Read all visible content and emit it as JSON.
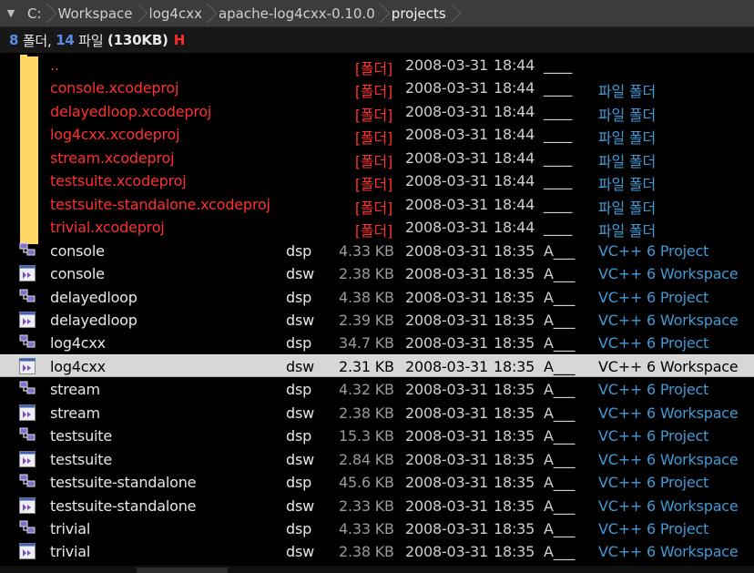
{
  "breadcrumb": [
    "C:",
    "Workspace",
    "log4cxx",
    "apache-log4cxx-0.10.0",
    "projects"
  ],
  "summary": {
    "folders": "8",
    "folder_label": "폴더,",
    "files": "14",
    "file_label": "파일",
    "size": "(130KB)",
    "flag": "H"
  },
  "colors": {
    "folder": "#ff3030",
    "type": "#3f9ad6",
    "count": "#5b8ee8",
    "selected_bg": "#d7d7d7"
  },
  "rows": [
    {
      "kind": "folder",
      "icon": "folder-icon",
      "name": "..",
      "ext": "",
      "size": "[폴더]",
      "date": "2008-03-31",
      "time": "18:44",
      "attr": "____",
      "type": ""
    },
    {
      "kind": "folder",
      "icon": "folder-icon",
      "name": "console.xcodeproj",
      "ext": "",
      "size": "[폴더]",
      "date": "2008-03-31",
      "time": "18:44",
      "attr": "____",
      "type": "파일 폴더"
    },
    {
      "kind": "folder",
      "icon": "folder-icon",
      "name": "delayedloop.xcodeproj",
      "ext": "",
      "size": "[폴더]",
      "date": "2008-03-31",
      "time": "18:44",
      "attr": "____",
      "type": "파일 폴더"
    },
    {
      "kind": "folder",
      "icon": "folder-icon",
      "name": "log4cxx.xcodeproj",
      "ext": "",
      "size": "[폴더]",
      "date": "2008-03-31",
      "time": "18:44",
      "attr": "____",
      "type": "파일 폴더"
    },
    {
      "kind": "folder",
      "icon": "folder-icon",
      "name": "stream.xcodeproj",
      "ext": "",
      "size": "[폴더]",
      "date": "2008-03-31",
      "time": "18:44",
      "attr": "____",
      "type": "파일 폴더"
    },
    {
      "kind": "folder",
      "icon": "folder-icon",
      "name": "testsuite.xcodeproj",
      "ext": "",
      "size": "[폴더]",
      "date": "2008-03-31",
      "time": "18:44",
      "attr": "____",
      "type": "파일 폴더"
    },
    {
      "kind": "folder",
      "icon": "folder-icon",
      "name": "testsuite-standalone.xcodeproj",
      "ext": "",
      "size": "[폴더]",
      "date": "2008-03-31",
      "time": "18:44",
      "attr": "____",
      "type": "파일 폴더"
    },
    {
      "kind": "folder",
      "icon": "folder-icon",
      "name": "trivial.xcodeproj",
      "ext": "",
      "size": "[폴더]",
      "date": "2008-03-31",
      "time": "18:44",
      "attr": "____",
      "type": "파일 폴더"
    },
    {
      "kind": "file",
      "icon": "dsp-project-icon",
      "name": "console",
      "ext": "dsp",
      "size": "4.33 KB",
      "date": "2008-03-31",
      "time": "18:35",
      "attr": "A___",
      "type": "VC++ 6 Project"
    },
    {
      "kind": "file",
      "icon": "dsw-workspace-icon",
      "name": "console",
      "ext": "dsw",
      "size": "2.38 KB",
      "date": "2008-03-31",
      "time": "18:35",
      "attr": "A___",
      "type": "VC++ 6 Workspace"
    },
    {
      "kind": "file",
      "icon": "dsp-project-icon",
      "name": "delayedloop",
      "ext": "dsp",
      "size": "4.38 KB",
      "date": "2008-03-31",
      "time": "18:35",
      "attr": "A___",
      "type": "VC++ 6 Project"
    },
    {
      "kind": "file",
      "icon": "dsw-workspace-icon",
      "name": "delayedloop",
      "ext": "dsw",
      "size": "2.39 KB",
      "date": "2008-03-31",
      "time": "18:35",
      "attr": "A___",
      "type": "VC++ 6 Workspace"
    },
    {
      "kind": "file",
      "icon": "dsp-project-icon",
      "name": "log4cxx",
      "ext": "dsp",
      "size": "34.7 KB",
      "date": "2008-03-31",
      "time": "18:35",
      "attr": "A___",
      "type": "VC++ 6 Project"
    },
    {
      "kind": "file",
      "icon": "dsw-workspace-icon",
      "name": "log4cxx",
      "ext": "dsw",
      "size": "2.31 KB",
      "date": "2008-03-31",
      "time": "18:35",
      "attr": "A___",
      "type": "VC++ 6 Workspace",
      "selected": true
    },
    {
      "kind": "file",
      "icon": "dsp-project-icon",
      "name": "stream",
      "ext": "dsp",
      "size": "4.32 KB",
      "date": "2008-03-31",
      "time": "18:35",
      "attr": "A___",
      "type": "VC++ 6 Project"
    },
    {
      "kind": "file",
      "icon": "dsw-workspace-icon",
      "name": "stream",
      "ext": "dsw",
      "size": "2.38 KB",
      "date": "2008-03-31",
      "time": "18:35",
      "attr": "A___",
      "type": "VC++ 6 Workspace"
    },
    {
      "kind": "file",
      "icon": "dsp-project-icon",
      "name": "testsuite",
      "ext": "dsp",
      "size": "15.3 KB",
      "date": "2008-03-31",
      "time": "18:35",
      "attr": "A___",
      "type": "VC++ 6 Project"
    },
    {
      "kind": "file",
      "icon": "dsw-workspace-icon",
      "name": "testsuite",
      "ext": "dsw",
      "size": "2.84 KB",
      "date": "2008-03-31",
      "time": "18:35",
      "attr": "A___",
      "type": "VC++ 6 Workspace"
    },
    {
      "kind": "file",
      "icon": "dsp-project-icon",
      "name": "testsuite-standalone",
      "ext": "dsp",
      "size": "45.6 KB",
      "date": "2008-03-31",
      "time": "18:35",
      "attr": "A___",
      "type": "VC++ 6 Project"
    },
    {
      "kind": "file",
      "icon": "dsw-workspace-icon",
      "name": "testsuite-standalone",
      "ext": "dsw",
      "size": "2.33 KB",
      "date": "2008-03-31",
      "time": "18:35",
      "attr": "A___",
      "type": "VC++ 6 Workspace"
    },
    {
      "kind": "file",
      "icon": "dsp-project-icon",
      "name": "trivial",
      "ext": "dsp",
      "size": "4.33 KB",
      "date": "2008-03-31",
      "time": "18:35",
      "attr": "A___",
      "type": "VC++ 6 Project"
    },
    {
      "kind": "file",
      "icon": "dsw-workspace-icon",
      "name": "trivial",
      "ext": "dsw",
      "size": "2.38 KB",
      "date": "2008-03-31",
      "time": "18:35",
      "attr": "A___",
      "type": "VC++ 6 Workspace"
    }
  ]
}
